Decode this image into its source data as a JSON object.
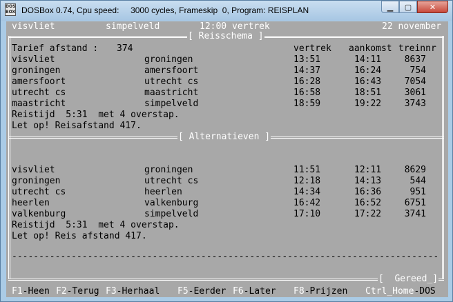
{
  "window": {
    "title": "DOSBox 0.74, Cpu speed:     3000 cycles, Frameskip  0, Program: REISPLAN",
    "icon_text": "DOS BOX",
    "buttons": [
      "minimize",
      "maximize",
      "close"
    ]
  },
  "header": {
    "from": "visvliet",
    "to": "simpelveld",
    "time": "12:00 vertrek",
    "date": "22 november"
  },
  "schema": {
    "title": "[ Reisschema ]",
    "tarief_label": "Tarief afstand :",
    "tarief_value": "374",
    "columns": [
      "vertrek",
      "aankomst",
      "treinnr"
    ],
    "rows": [
      {
        "from": "visvliet",
        "to": "groningen",
        "dep": "13:51",
        "arr": "14:11",
        "train": "8637"
      },
      {
        "from": "groningen",
        "to": "amersfoort",
        "dep": "14:37",
        "arr": "16:24",
        "train": "754"
      },
      {
        "from": "amersfoort",
        "to": "utrecht cs",
        "dep": "16:28",
        "arr": "16:43",
        "train": "7054"
      },
      {
        "from": "utrecht cs",
        "to": "maastricht",
        "dep": "16:58",
        "arr": "18:51",
        "train": "3061"
      },
      {
        "from": "maastricht",
        "to": "simpelveld",
        "dep": "18:59",
        "arr": "19:22",
        "train": "3743"
      }
    ],
    "reistijd": "Reistijd  5:31  met 4 overstap.",
    "note": "Let op! Reisafstand 417."
  },
  "alternatieven": {
    "title": "[ Alternatieven ]",
    "rows": [
      {
        "from": "visvliet",
        "to": "groningen",
        "dep": "11:51",
        "arr": "12:11",
        "train": "8629"
      },
      {
        "from": "groningen",
        "to": "utrecht cs",
        "dep": "12:18",
        "arr": "14:13",
        "train": "544"
      },
      {
        "from": "utrecht cs",
        "to": "heerlen",
        "dep": "14:34",
        "arr": "16:36",
        "train": "951"
      },
      {
        "from": "heerlen",
        "to": "valkenburg",
        "dep": "16:42",
        "arr": "16:52",
        "train": "6751"
      },
      {
        "from": "valkenburg",
        "to": "simpelveld",
        "dep": "17:10",
        "arr": "17:22",
        "train": "3741"
      }
    ],
    "reistijd": "Reistijd  5:31  met 4 overstap.",
    "note": "Let op! Reis afstand 417."
  },
  "status": "[  Gereed_]",
  "dashes": "----------------------------------------------------------------------------------",
  "fkeys": [
    {
      "key": "F1",
      "label": "-Heen"
    },
    {
      "key": "F2",
      "label": "-Terug"
    },
    {
      "key": "F3",
      "label": "-Herhaal"
    },
    {
      "key": "F5",
      "label": "-Eerder"
    },
    {
      "key": "F6",
      "label": "-Later"
    },
    {
      "key": "F8",
      "label": "-Prijzen"
    },
    {
      "key": "Ctrl_Home",
      "label": "-DOS"
    }
  ]
}
